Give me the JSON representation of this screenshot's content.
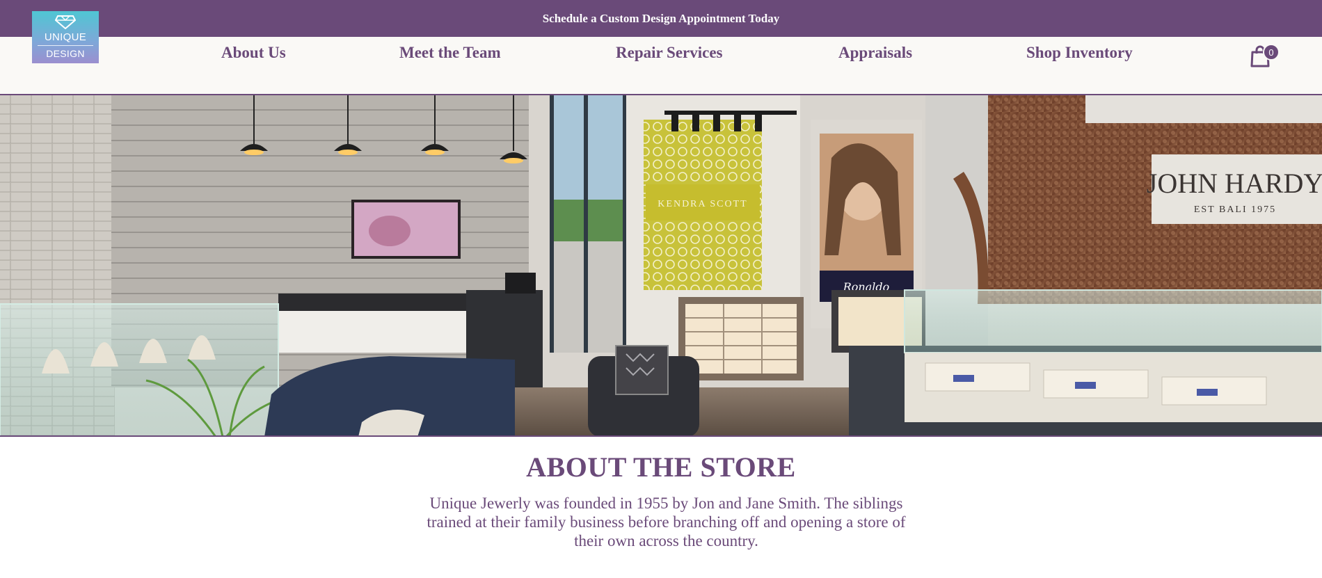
{
  "promo": {
    "text": "Schedule a Custom Design Appointment Today"
  },
  "logo": {
    "line1": "UNIQUE",
    "line2": "DESIGN"
  },
  "nav": {
    "links": [
      {
        "label": "About Us"
      },
      {
        "label": "Meet the Team"
      },
      {
        "label": "Repair Services"
      },
      {
        "label": "Appraisals"
      },
      {
        "label": "Shop Inventory"
      }
    ]
  },
  "cart": {
    "count": "0",
    "icon": "shopping-bag-icon"
  },
  "hero": {
    "signs": {
      "kendra": "KENDRA SCOTT",
      "john_hardy": "JOHN HARDY",
      "john_hardy_sub": "EST BALI 1975",
      "ronaldo": "Ronaldo"
    }
  },
  "about": {
    "title": "ABOUT THE STORE",
    "body": "Unique Jewerly was founded in 1955 by Jon and Jane Smith. The siblings trained at their family business before branching off and opening a store of their own across the country."
  },
  "colors": {
    "brand_purple": "#6a4a79",
    "nav_background": "#faf9f6",
    "logo_teal": "#4fc6d3"
  }
}
